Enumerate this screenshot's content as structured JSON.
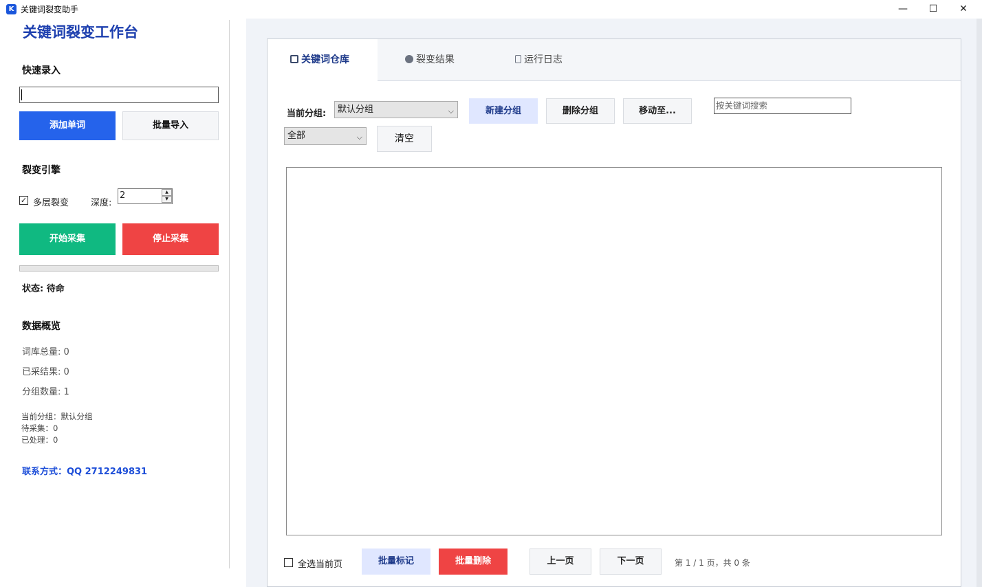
{
  "window": {
    "title": "关键词裂变助手",
    "icon_letter": "K",
    "min": "—",
    "max": "☐",
    "close": "✕"
  },
  "sidebar": {
    "title": "关键词裂变工作台",
    "quick_entry": {
      "heading": "快速录入",
      "input_value": "",
      "add_button": "添加单词",
      "import_button": "批量导入"
    },
    "engine": {
      "heading": "裂变引擎",
      "multi_layer_label": "多层裂变",
      "multi_layer_checked": true,
      "depth_label": "深度:",
      "depth_value": "2",
      "start_button": "开始采集",
      "stop_button": "停止采集"
    },
    "progress": 0,
    "status": "状态: 待命",
    "overview": {
      "heading": "数据概览",
      "total": "词库总量: 0",
      "collected": "已采结果: 0",
      "groups": "分组数量: 1",
      "current_group": "当前分组：默认分组",
      "pending": "待采集：0",
      "processed": "已处理：0"
    },
    "contact": "联系方式：QQ 2712249831"
  },
  "tabs": [
    {
      "label": "关键词仓库",
      "icon": "book-icon",
      "active": true
    },
    {
      "label": "裂变结果",
      "icon": "globe-icon",
      "active": false
    },
    {
      "label": "运行日志",
      "icon": "notebook-icon",
      "active": false
    }
  ],
  "toolbar": {
    "group_label": "当前分组:",
    "group_selected": "默认分组",
    "new_group": "新建分组",
    "delete_group": "删除分组",
    "move_to": "移动至...",
    "search_placeholder": "按关键词搜索",
    "filter_selected": "全部",
    "clear": "清空"
  },
  "footer": {
    "select_page_label": "全选当前页",
    "batch_mark": "批量标记",
    "batch_delete": "批量删除",
    "prev": "上一页",
    "next": "下一页",
    "page_info": "第 1 / 1 页，共 0 条"
  }
}
